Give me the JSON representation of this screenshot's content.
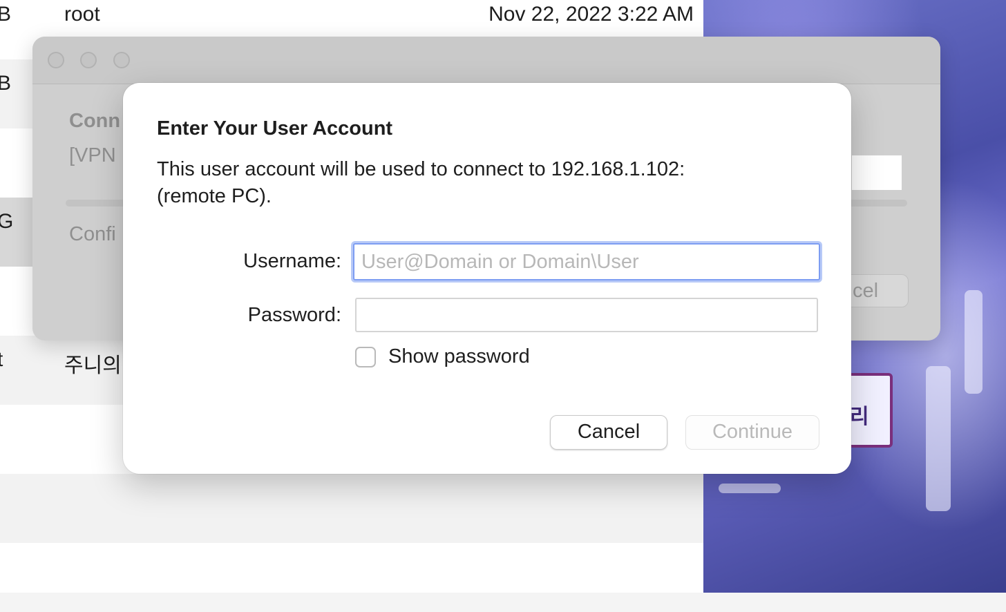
{
  "background_list": {
    "rows": [
      {
        "left_edge": "B",
        "name": "root",
        "date": "Nov 22, 2022 3:22 AM"
      },
      {
        "left_edge": "B",
        "name": "",
        "date": ""
      },
      {
        "left_edge": "",
        "name": "",
        "date": ""
      },
      {
        "left_edge": "G",
        "name": "",
        "date": ""
      },
      {
        "left_edge": "",
        "name": "",
        "date": ""
      },
      {
        "left_edge": "t",
        "name": "주니의.",
        "date": ""
      }
    ]
  },
  "wallpaper": {
    "sign_text": "리"
  },
  "parent_window": {
    "heading": "Conn",
    "vpn_text": "[VPN",
    "config_text": "Confi",
    "button_label": "cel"
  },
  "dialog": {
    "title": "Enter Your User Account",
    "message_line1": "This user account will be used to connect to 192.168.1.102:",
    "message_line2": "(remote PC).",
    "username_label": "Username:",
    "username_placeholder": "User@Domain or Domain\\User",
    "username_value": "",
    "password_label": "Password:",
    "password_value": "",
    "show_password_label": "Show password",
    "show_password_checked": false,
    "cancel_label": "Cancel",
    "continue_label": "Continue"
  },
  "colors": {
    "focus_ring": "#7d9df2",
    "disabled_text": "#b9b9b9"
  }
}
